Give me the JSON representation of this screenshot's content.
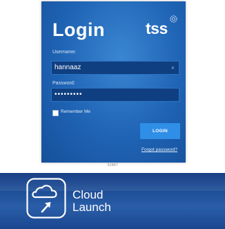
{
  "login": {
    "title": "Login",
    "logo_text": "tss",
    "username_label": "Username:",
    "username_value": "hannaaz",
    "clear_glyph": "×",
    "password_label": "Password:",
    "password_value": "•••••••••",
    "remember_label": "Remember Me",
    "remember_checked": false,
    "login_button": "LOGIN",
    "forgot_link": "Forgot password?",
    "accent_color": "#2f8ee6",
    "panel_color": "#1f63b4"
  },
  "caption": "31897",
  "banner": {
    "icon": "cloud-launch-icon",
    "line1": "Cloud",
    "line2": "Launch",
    "color": "#1f4f99"
  }
}
